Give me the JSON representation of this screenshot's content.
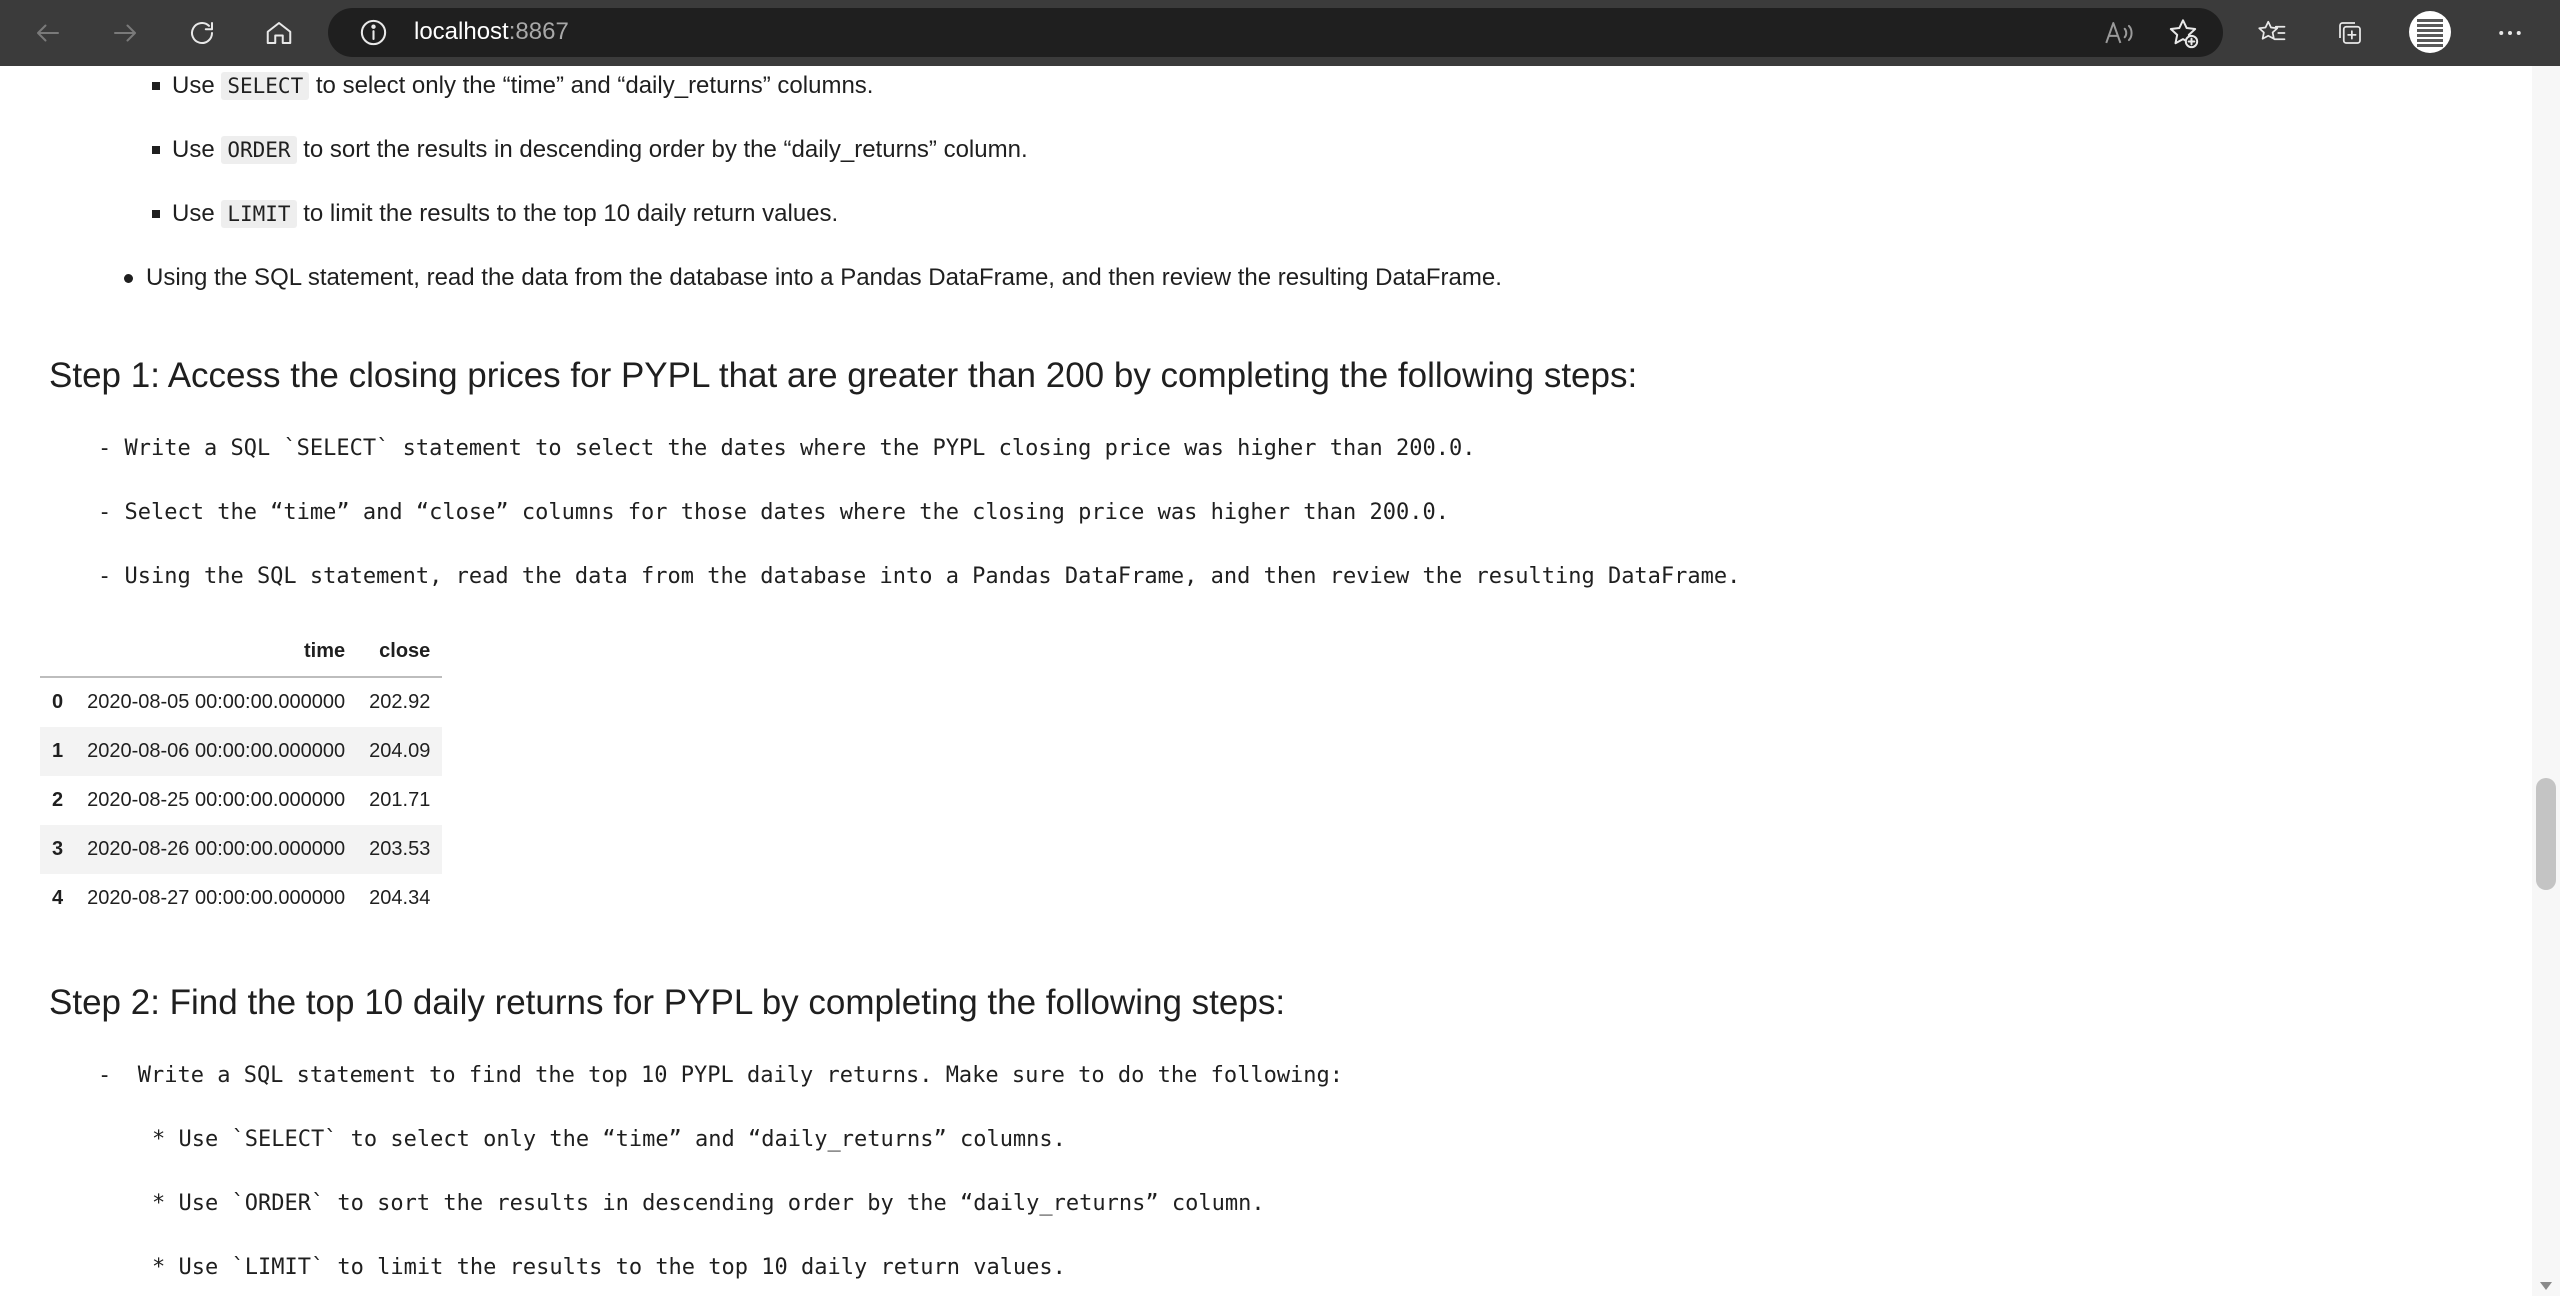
{
  "browser": {
    "url_host": "localhost",
    "url_port": ":8867"
  },
  "top_list": {
    "items": [
      {
        "pre": "Use ",
        "code": "SELECT",
        "post": " to select only the “time” and “daily_returns” columns."
      },
      {
        "pre": "Use ",
        "code": "ORDER",
        "post": " to sort the results in descending order by the “daily_returns” column."
      },
      {
        "pre": "Use ",
        "code": "LIMIT",
        "post": " to limit the results to the top 10 daily return values."
      }
    ],
    "bullet": "Using the SQL statement, read the data from the database into a Pandas DataFrame, and then review the resulting DataFrame."
  },
  "step1": {
    "title": "Step 1: Access the closing prices for PYPL that are greater than 200 by completing the following steps:",
    "lines": [
      "- Write a SQL `SELECT` statement to select the dates where the PYPL closing price was higher than 200.0.",
      "- Select the “time” and “close” columns for those dates where the closing price was higher than 200.0.",
      "- Using the SQL statement, read the data from the database into a Pandas DataFrame, and then review the resulting DataFrame."
    ]
  },
  "dataframe": {
    "columns": [
      "time",
      "close"
    ],
    "rows": [
      {
        "index": "0",
        "time": "2020-08-05 00:00:00.000000",
        "close": "202.92"
      },
      {
        "index": "1",
        "time": "2020-08-06 00:00:00.000000",
        "close": "204.09"
      },
      {
        "index": "2",
        "time": "2020-08-25 00:00:00.000000",
        "close": "201.71"
      },
      {
        "index": "3",
        "time": "2020-08-26 00:00:00.000000",
        "close": "203.53"
      },
      {
        "index": "4",
        "time": "2020-08-27 00:00:00.000000",
        "close": "204.34"
      }
    ]
  },
  "step2": {
    "title": "Step 2: Find the top 10 daily returns for PYPL by completing the following steps:",
    "lines": [
      "-  Write a SQL statement to find the top 10 PYPL daily returns. Make sure to do the following:",
      "* Use `SELECT` to select only the “time” and “daily_returns” columns.",
      "* Use `ORDER` to sort the results in descending order by the “daily_returns” column.",
      "* Use `LIMIT` to limit the results to the top 10 daily return values."
    ]
  }
}
